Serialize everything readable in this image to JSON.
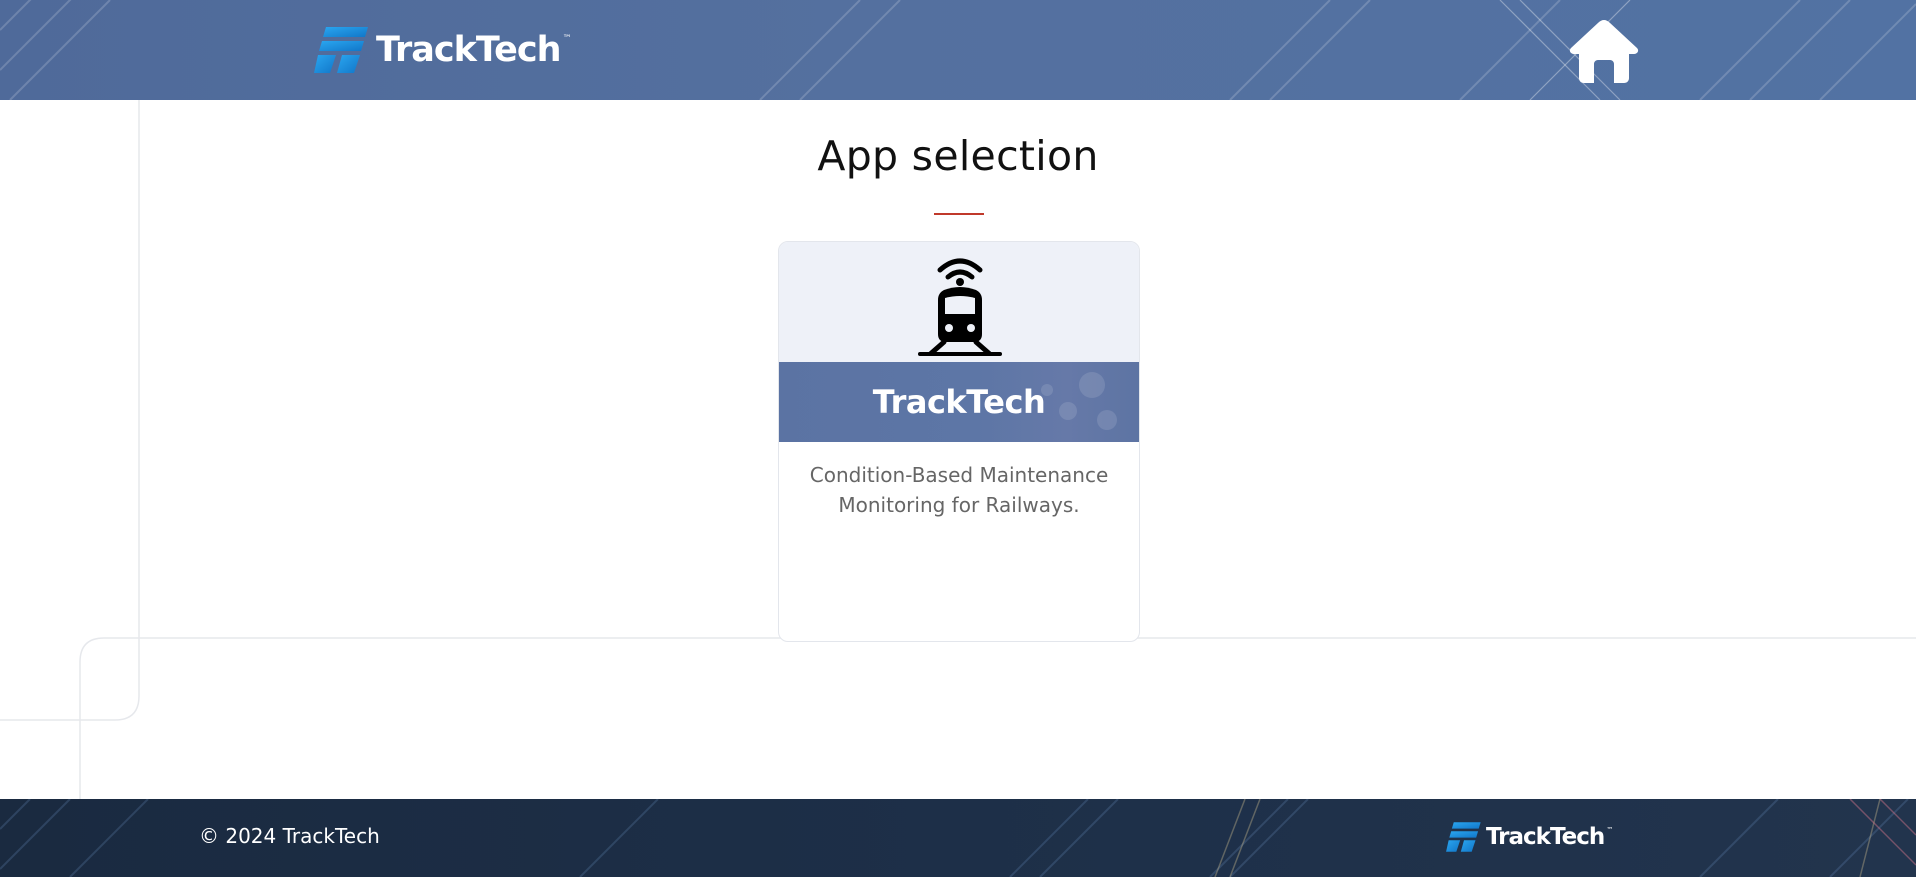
{
  "header": {
    "logo_text": "TrackTech",
    "logo_tm": "™",
    "logo_icon": "tracktech-logo-mark",
    "home_icon": "home-icon"
  },
  "main": {
    "title": "App selection",
    "accent_color": "#c0392b",
    "apps": [
      {
        "name": "TrackTech",
        "icon": "train-signal-icon",
        "description_line1": "Condition-Based Maintenance",
        "description_line2": "Monitoring for Railways."
      }
    ]
  },
  "footer": {
    "copyright": "© 2024 TrackTech",
    "logo_text": "TrackTech",
    "logo_tm": "™"
  },
  "colors": {
    "header_bg": "#54709f",
    "footer_bg": "#1d2f48",
    "logo_blue": "#1a8fe0"
  }
}
